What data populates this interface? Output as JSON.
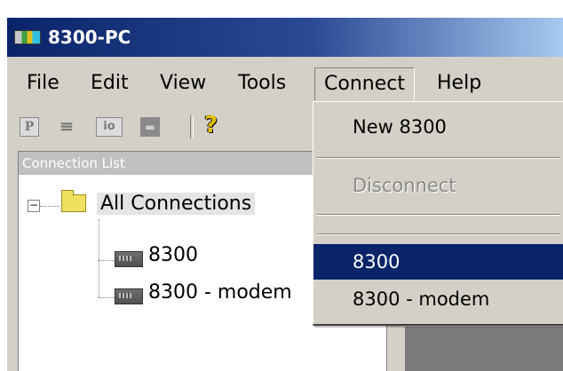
{
  "window": {
    "title": "8300-PC"
  },
  "menubar": {
    "items": [
      {
        "label": "File"
      },
      {
        "label": "Edit"
      },
      {
        "label": "View"
      },
      {
        "label": "Tools"
      },
      {
        "label": "Connect"
      },
      {
        "label": "Help"
      }
    ],
    "open_menu": "Connect"
  },
  "toolbar": {
    "buttons": [
      {
        "glyph": "P",
        "icon": "page-icon"
      },
      {
        "glyph": "≡",
        "icon": "document-icon"
      },
      {
        "glyph": "io",
        "icon": "io-icon"
      },
      {
        "glyph": "▬",
        "icon": "save-icon"
      }
    ],
    "help_glyph": "?"
  },
  "connection_list": {
    "header": "Connection List",
    "tree": {
      "expander": "−",
      "root": "All Connections",
      "children": [
        "8300",
        "8300 - modem"
      ]
    }
  },
  "connect_menu": {
    "items": [
      {
        "label": "New 8300",
        "state": "enabled"
      },
      {
        "label": "Disconnect",
        "state": "disabled"
      },
      {
        "label": "8300",
        "state": "highlighted"
      },
      {
        "label": "8300 - modem",
        "state": "enabled"
      }
    ]
  },
  "colors": {
    "titlebar": "#0a246a",
    "face": "#d4d0c8",
    "highlight": "#0a246a"
  }
}
